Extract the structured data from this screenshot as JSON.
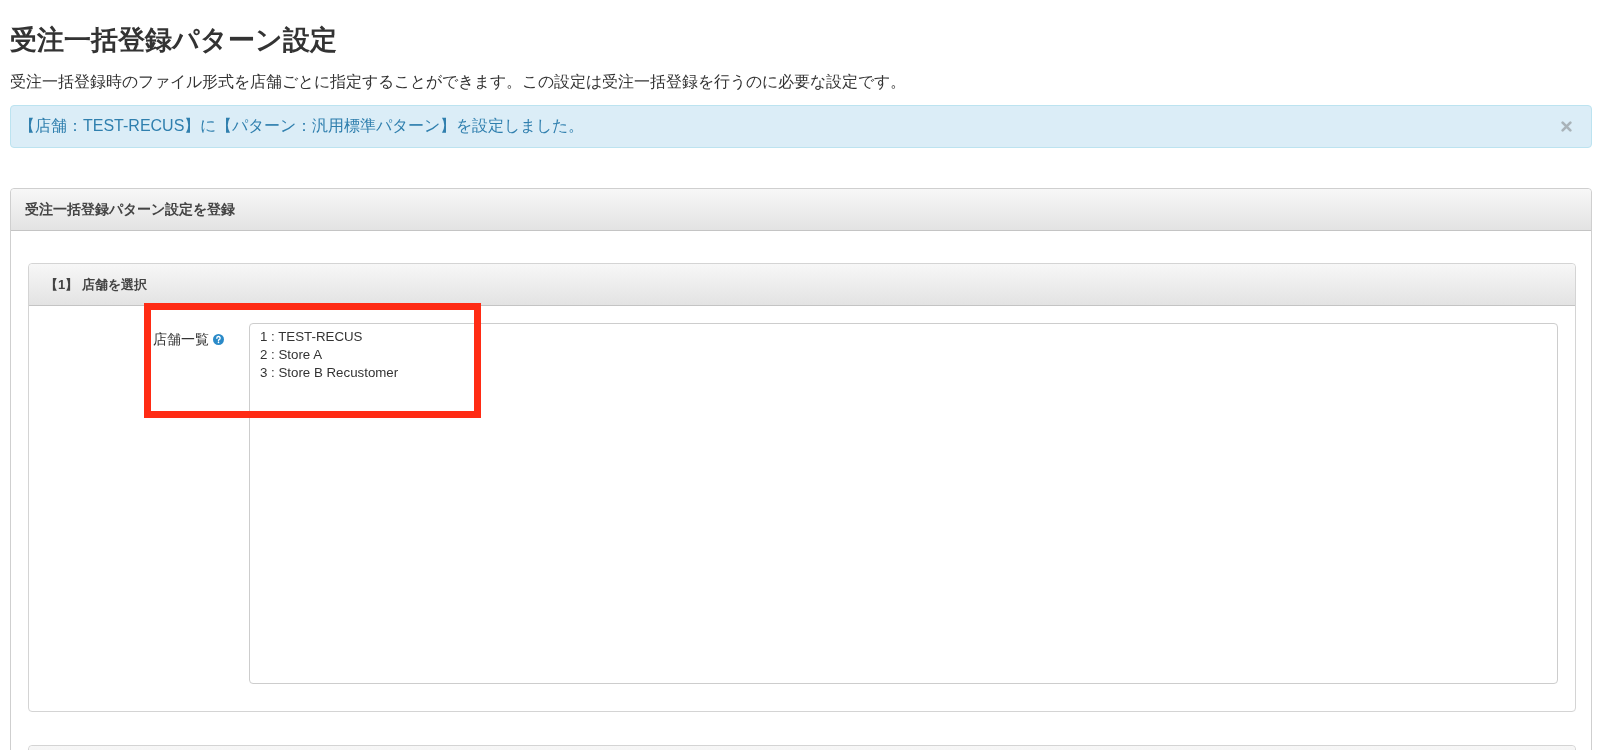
{
  "page": {
    "title": "受注一括登録パターン設定",
    "description": "受注一括登録時のファイル形式を店舗ごとに指定することができます。この設定は受注一括登録を行うのに必要な設定です。"
  },
  "alert": {
    "message": "【店舗：TEST-RECUS】に【パターン：汎用標準パターン】を設定しました。",
    "dismissible": true
  },
  "panel": {
    "title": "受注一括登録パターン設定を登録",
    "sections": [
      {
        "kind": "form",
        "title": "【1】 店舗を選択",
        "fields": [
          {
            "label": "店舗一覧",
            "help": true,
            "kind": "listbox",
            "highlighted": true,
            "options": [
              "1 : TEST-RECUS",
              "2 : Store A",
              "3 : Store B Recustomer"
            ]
          }
        ]
      },
      {
        "kind": "cut_off"
      }
    ]
  }
}
